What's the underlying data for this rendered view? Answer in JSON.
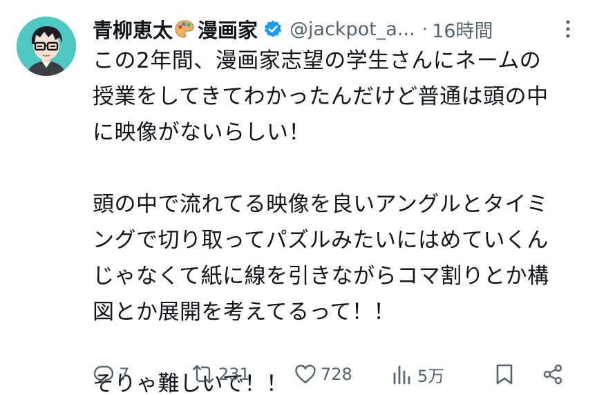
{
  "author": {
    "display_name": "青柳恵太",
    "display_name_suffix": "漫画家",
    "name_emoji_icon": "artist-palette-icon",
    "verified_icon": "verified-badge-icon",
    "handle": "@jackpot_a...",
    "separator": "·",
    "timestamp": "16時間"
  },
  "tweet": {
    "lines": [
      "この2年間、漫画家志望の学生さんにネームの",
      "授業をしてきてわかったんだけど普通は頭の中",
      "に映像がないらしい！",
      "",
      "頭の中で流れてる映像を良いアングルとタイミ",
      "ングで切り取ってパズルみたいにはめていくん",
      "じゃなくて紙に線を引きながらコマ割りとか構",
      "図とか展開を考えてるって！！",
      "",
      "そりゃ難しいで！！"
    ]
  },
  "actions": {
    "reply": {
      "icon": "reply-icon",
      "count": "7"
    },
    "retweet": {
      "icon": "retweet-icon",
      "count": "231"
    },
    "like": {
      "icon": "heart-icon",
      "count": "728"
    },
    "views": {
      "icon": "views-icon",
      "count": "5万"
    },
    "bookmark": {
      "icon": "bookmark-icon"
    },
    "share": {
      "icon": "share-icon"
    }
  },
  "colors": {
    "text": "#0f1419",
    "secondary": "#536471",
    "verified": "#1d9bf0",
    "avatar_bg": "#4fc7c2"
  }
}
